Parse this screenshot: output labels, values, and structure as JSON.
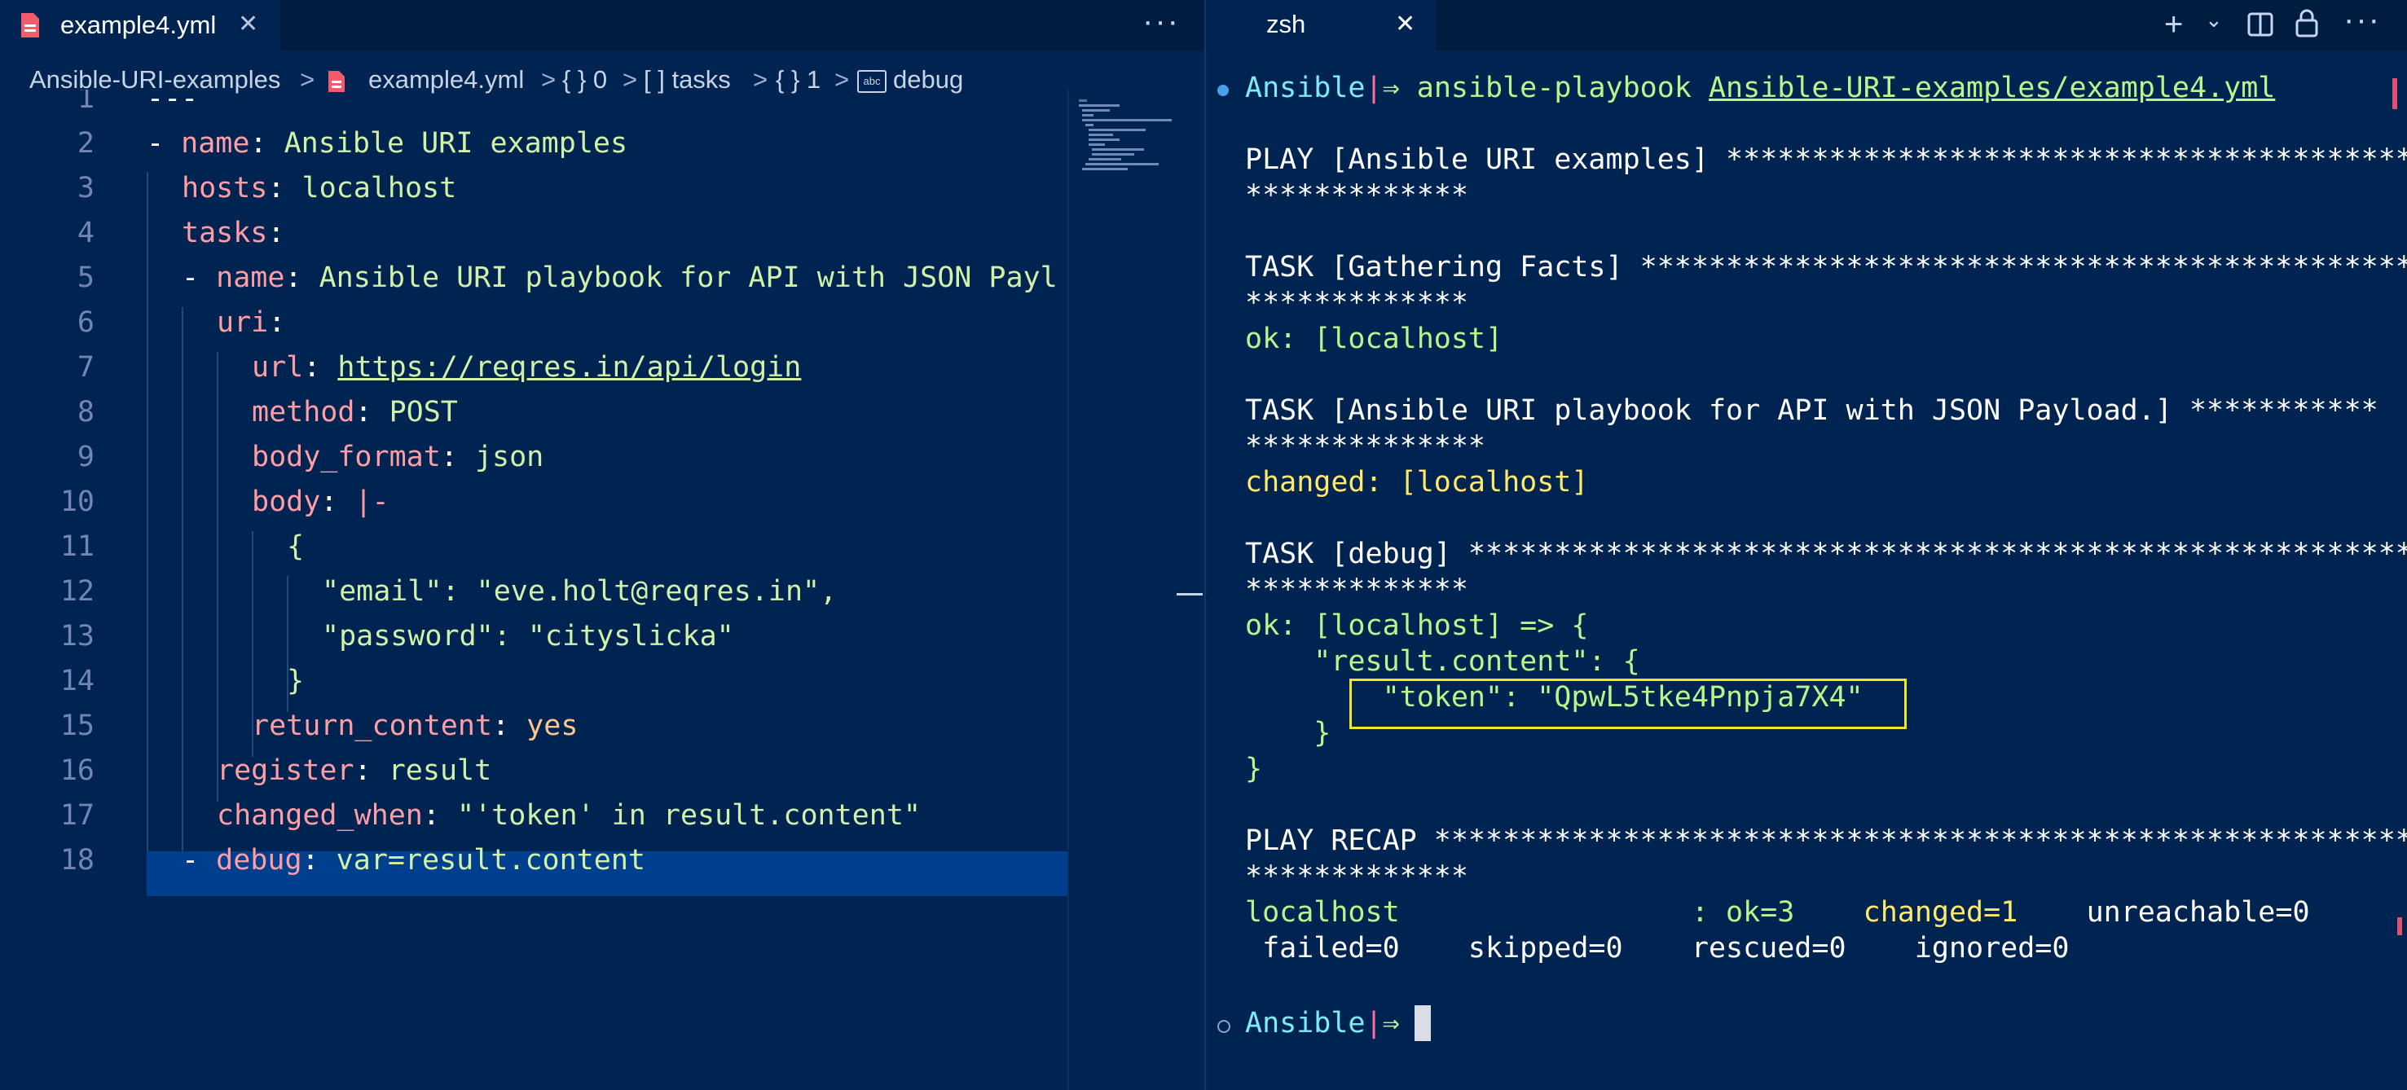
{
  "editor": {
    "tab": {
      "label": "example4.yml",
      "close": "✕"
    },
    "more": "···",
    "breadcrumb": {
      "folder": "Ansible-URI-examples",
      "file": "example4.yml",
      "item0": "{ } 0",
      "tasks": "[ ] tasks",
      "item1": "{ } 1",
      "abc": "abc",
      "debug": "debug",
      "sep": ">"
    },
    "lines": {
      "n1": "1",
      "n2": "2",
      "n3": "3",
      "n4": "4",
      "n5": "5",
      "n6": "6",
      "n7": "7",
      "n8": "8",
      "n9": "9",
      "n10": "10",
      "n11": "11",
      "n12": "12",
      "n13": "13",
      "n14": "14",
      "n15": "15",
      "n16": "16",
      "n17": "17",
      "n18": "18",
      "l1": "---",
      "dash": "-",
      "name": "name",
      "colon": ":",
      "l2_val": "Ansible URI examples",
      "hosts": "hosts",
      "l3_val": "localhost",
      "tasks": "tasks",
      "l5_val": "Ansible URI playbook for API with JSON Payl",
      "uri": "uri",
      "url": "url",
      "l7_val": "https://reqres.in/api/login",
      "method": "method",
      "l8_val": "POST",
      "body_format": "body_format",
      "l9_val": "json",
      "body": "body",
      "l10_val": "|-",
      "l11": "{",
      "l12": "\"email\": \"eve.holt@reqres.in\",",
      "l13": "\"password\": \"cityslicka\"",
      "l14": "}",
      "return_content": "return_content",
      "l15_val": "yes",
      "register": "register",
      "l16_val": "result",
      "changed_when": "changed_when",
      "l17_val": "\"'token' in result.content\"",
      "debug": "debug",
      "l18_val": "var=result.content"
    }
  },
  "terminal": {
    "tab": {
      "label": "zsh",
      "close": "✕"
    },
    "icons": {
      "add": "+",
      "chevron": "⌄",
      "split": "◫",
      "lock": "🔒",
      "more": "···"
    },
    "prompt": "Ansible",
    "prompt_bar": "|",
    "prompt_arrow": "⇒",
    "command": "ansible-playbook",
    "command_arg": "Ansible-URI-examples/example4.yml",
    "out": {
      "play": "PLAY [Ansible URI examples] ****************************************",
      "stars13": "*************",
      "stars14": "**************",
      "task1": "TASK [Gathering Facts] *********************************************",
      "ok1": "ok: [localhost]",
      "task2": "TASK [Ansible URI playbook for API with JSON Payload.] ***********",
      "changed": "changed: [localhost]",
      "task3": "TASK [debug] *******************************************************",
      "ok2": "ok: [localhost] => {",
      "result_content": "    \"result.content\": {",
      "token": "        \"token\": \"QpwL5tke4Pnpja7X4\"",
      "close_inner": "    }",
      "close_outer": "}",
      "recap": "PLAY RECAP *********************************************************",
      "recap_host": "localhost",
      "recap_sep": ": ok=3",
      "recap_changed": "changed=1",
      "recap_unreach": "unreachable=0",
      "recap_line2": " failed=0    skipped=0    rescued=0    ignored=0"
    }
  },
  "colors": {
    "background": "#002451",
    "tabbar": "#001c40",
    "key": "#ff9da4",
    "string": "#d1f1a9",
    "terminal_cyan": "#7fe9f5",
    "terminal_green": "#b8f58c",
    "terminal_yellow": "#ffe96b",
    "highlight_box": "#f1e629"
  }
}
